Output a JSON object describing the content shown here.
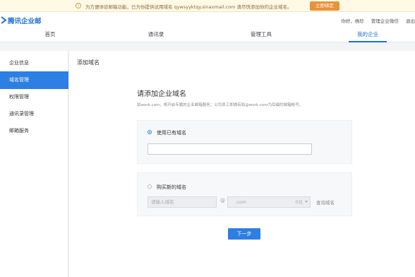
{
  "notice": {
    "message": "为方便体验邮箱功能，已为你提供试用域名 qywsyyktqy.sinaxmail.com 请尽快添加你的企业域名。",
    "button": "立即绑定"
  },
  "header": {
    "logo_text": "腾讯企业邮",
    "links": [
      "你好，杨珍",
      "管理企业微信",
      "退出"
    ]
  },
  "nav": {
    "tabs": [
      {
        "label": "首页"
      },
      {
        "label": "通讯录"
      },
      {
        "label": "管理工具"
      },
      {
        "label": "我的企业",
        "active": true
      }
    ]
  },
  "sidebar": {
    "items": [
      {
        "label": "企业信息"
      },
      {
        "label": "域名管理",
        "active": true
      },
      {
        "label": "权限管理"
      },
      {
        "label": "通讯录管理"
      },
      {
        "label": "邮箱服务"
      }
    ]
  },
  "main": {
    "page_title": "添加域名",
    "form_title": "请添加企业域名",
    "form_desc": "如work.com，将开启专属的企业邮箱服务；公司员工即拥有如@work.com为后缀的邮箱帐号。",
    "option_existing": {
      "label": "使用已有域名",
      "selected": true,
      "value": ""
    },
    "option_buy": {
      "label": "购买新的域名",
      "selected": false,
      "prefix_placeholder": "请输入域名",
      "at": "@",
      "suffix_value": ".com",
      "suffix_price": "0元",
      "query_link": "查询域名"
    },
    "next_button": "下一步"
  },
  "colors": {
    "accent": "#2d7fe3",
    "notice_button": "#e8923a",
    "notice_bg": "#fff9e6"
  }
}
